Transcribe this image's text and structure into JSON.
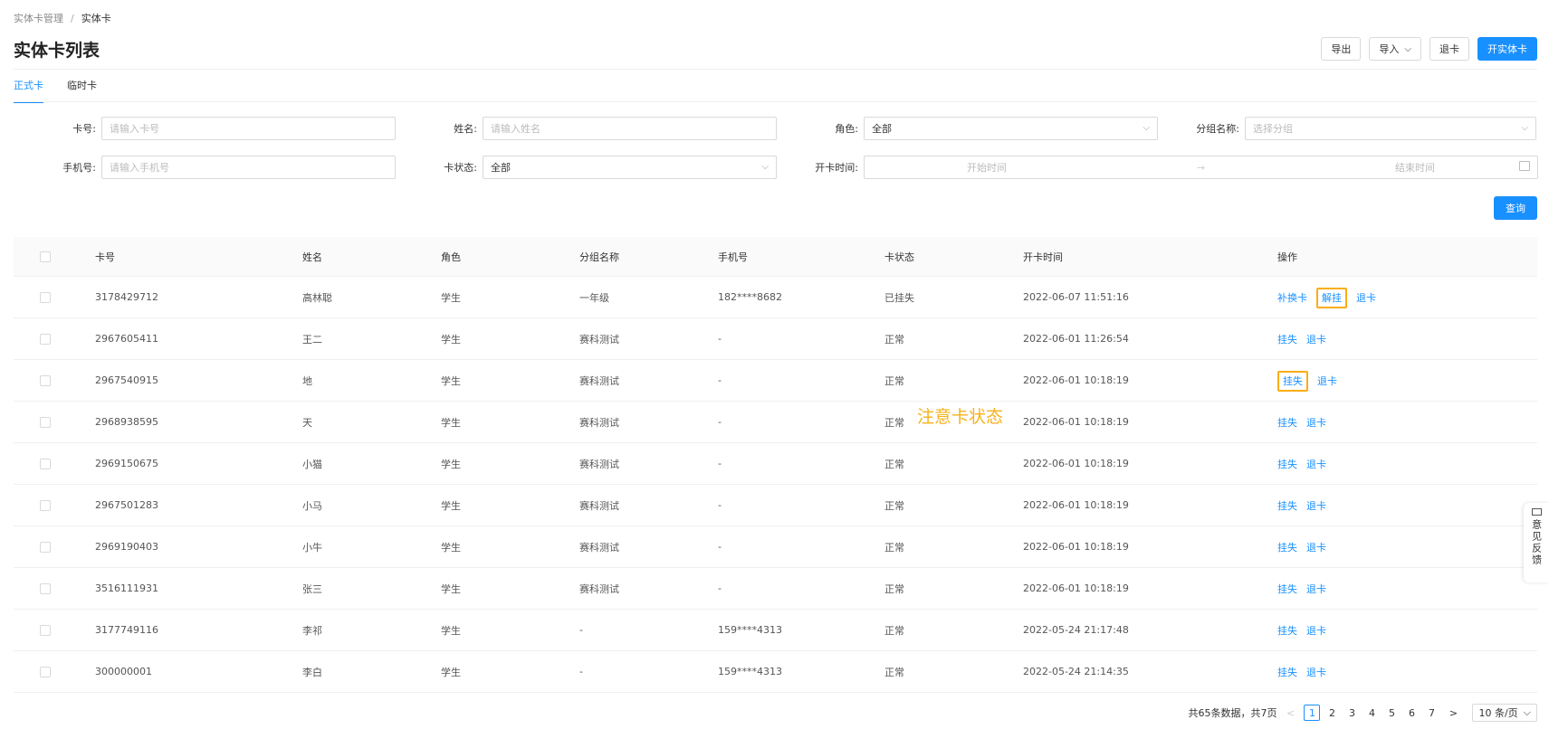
{
  "breadcrumb": {
    "parent": "实体卡管理",
    "separator": "/",
    "current": "实体卡"
  },
  "title": "实体卡列表",
  "actions": {
    "export": "导出",
    "import": "导入",
    "refund": "退卡",
    "open": "开实体卡"
  },
  "tabs": [
    {
      "label": "正式卡",
      "active": true
    },
    {
      "label": "临时卡",
      "active": false
    }
  ],
  "filters": {
    "card_no": {
      "label": "卡号:",
      "placeholder": "请输入卡号"
    },
    "name": {
      "label": "姓名:",
      "placeholder": "请输入姓名"
    },
    "role": {
      "label": "角色:",
      "value": "全部"
    },
    "group": {
      "label": "分组名称:",
      "placeholder": "选择分组"
    },
    "phone": {
      "label": "手机号:",
      "placeholder": "请输入手机号"
    },
    "status": {
      "label": "卡状态:",
      "value": "全部"
    },
    "open_time": {
      "label": "开卡时间:",
      "start": "开始时间",
      "end": "结束时间"
    },
    "query": "查询"
  },
  "table": {
    "headers": {
      "card": "卡号",
      "name": "姓名",
      "role": "角色",
      "group": "分组名称",
      "phone": "手机号",
      "status": "卡状态",
      "time": "开卡时间",
      "ops": "操作"
    },
    "rows": [
      {
        "card": "3178429712",
        "name": "高林聪",
        "role": "学生",
        "group": "一年级",
        "phone": "182****8682",
        "status": "已挂失",
        "time": "2022-06-07 11:51:16",
        "ops": [
          "补换卡",
          "解挂",
          "退卡"
        ]
      },
      {
        "card": "2967605411",
        "name": "王二",
        "role": "学生",
        "group": "赛科测试",
        "phone": "-",
        "status": "正常",
        "time": "2022-06-01 11:26:54",
        "ops": [
          "挂失",
          "退卡"
        ]
      },
      {
        "card": "2967540915",
        "name": "地",
        "role": "学生",
        "group": "赛科测试",
        "phone": "-",
        "status": "正常",
        "time": "2022-06-01 10:18:19",
        "ops": [
          "挂失",
          "退卡"
        ]
      },
      {
        "card": "2968938595",
        "name": "天",
        "role": "学生",
        "group": "赛科测试",
        "phone": "-",
        "status": "正常",
        "time": "2022-06-01 10:18:19",
        "ops": [
          "挂失",
          "退卡"
        ]
      },
      {
        "card": "2969150675",
        "name": "小猫",
        "role": "学生",
        "group": "赛科测试",
        "phone": "-",
        "status": "正常",
        "time": "2022-06-01 10:18:19",
        "ops": [
          "挂失",
          "退卡"
        ]
      },
      {
        "card": "2967501283",
        "name": "小马",
        "role": "学生",
        "group": "赛科测试",
        "phone": "-",
        "status": "正常",
        "time": "2022-06-01 10:18:19",
        "ops": [
          "挂失",
          "退卡"
        ]
      },
      {
        "card": "2969190403",
        "name": "小牛",
        "role": "学生",
        "group": "赛科测试",
        "phone": "-",
        "status": "正常",
        "time": "2022-06-01 10:18:19",
        "ops": [
          "挂失",
          "退卡"
        ]
      },
      {
        "card": "3516111931",
        "name": "张三",
        "role": "学生",
        "group": "赛科测试",
        "phone": "-",
        "status": "正常",
        "time": "2022-06-01 10:18:19",
        "ops": [
          "挂失",
          "退卡"
        ]
      },
      {
        "card": "3177749116",
        "name": "李祁",
        "role": "学生",
        "group": "-",
        "phone": "159****4313",
        "status": "正常",
        "time": "2022-05-24 21:17:48",
        "ops": [
          "挂失",
          "退卡"
        ]
      },
      {
        "card": "300000001",
        "name": "李白",
        "role": "学生",
        "group": "-",
        "phone": "159****4313",
        "status": "正常",
        "time": "2022-05-24 21:14:35",
        "ops": [
          "挂失",
          "退卡"
        ]
      }
    ]
  },
  "annotation": "注意卡状态",
  "pagination": {
    "summary": "共65条数据，共7页",
    "prev": "<",
    "next": ">",
    "pages": [
      "1",
      "2",
      "3",
      "4",
      "5",
      "6",
      "7"
    ],
    "current": "1",
    "page_size": "10 条/页"
  },
  "feedback": "意见反馈",
  "colors": {
    "primary": "#1890ff",
    "highlight": "#faad14",
    "annotation": "#f5b21b"
  }
}
